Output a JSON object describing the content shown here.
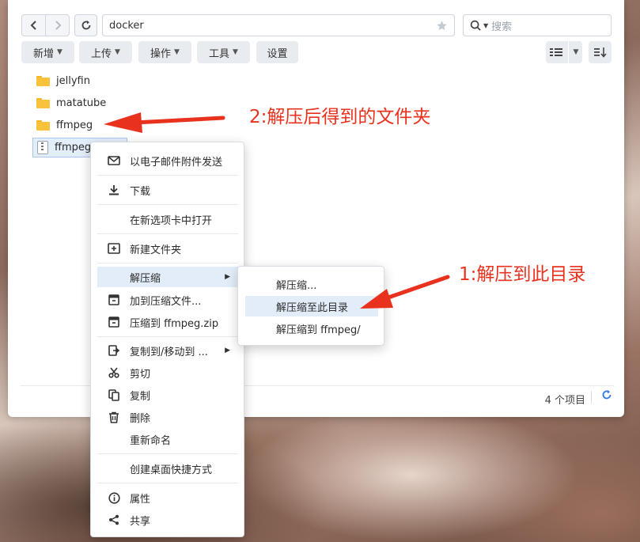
{
  "navigation": {
    "back_icon": "chevron-left-icon",
    "forward_icon": "chevron-right-icon",
    "refresh_icon": "refresh-icon"
  },
  "path": {
    "value": "docker",
    "favorite_icon": "star-icon"
  },
  "search": {
    "placeholder": "搜索",
    "icon": "search-icon"
  },
  "toolbar": {
    "buttons": [
      "新增",
      "上传",
      "操作",
      "工具"
    ],
    "settings_label": "设置",
    "view_icon": "list-view-icon",
    "sort_icon": "sort-icon"
  },
  "files": [
    {
      "name": "jellyfin",
      "type": "folder"
    },
    {
      "name": "matatube",
      "type": "folder"
    },
    {
      "name": "ffmpeg",
      "type": "folder"
    },
    {
      "name": "ffmpeg",
      "type": "zip",
      "selected": true
    }
  ],
  "status": {
    "count": "4 个项目"
  },
  "context_menu": {
    "items": [
      {
        "label": "以电子邮件附件发送",
        "icon": "mail-icon"
      },
      {
        "label": "下载",
        "icon": "download-icon"
      },
      {
        "label": "在新选项卡中打开",
        "icon": ""
      },
      {
        "label": "新建文件夹",
        "icon": "new-folder-icon"
      },
      {
        "label": "解压缩",
        "icon": "",
        "submenu": true
      },
      {
        "label": "加到压缩文件...",
        "icon": "archive-add-icon"
      },
      {
        "label": "压缩到 ffmpeg.zip",
        "icon": "archive-icon"
      },
      {
        "label": "复制到/移动到 ...",
        "icon": "copy-move-icon",
        "submenu": true
      },
      {
        "label": "剪切",
        "icon": "scissors-icon"
      },
      {
        "label": "复制",
        "icon": "copy-icon"
      },
      {
        "label": "删除",
        "icon": "trash-icon"
      },
      {
        "label": "重新命名",
        "icon": ""
      },
      {
        "label": "创建桌面快捷方式",
        "icon": ""
      },
      {
        "label": "属性",
        "icon": "info-icon"
      },
      {
        "label": "共享",
        "icon": "share-icon"
      }
    ]
  },
  "submenu": {
    "items": [
      "解压缩...",
      "解压缩至此目录",
      "解压缩到 ffmpeg/"
    ]
  },
  "annotations": {
    "first": "2:解压后得到的文件夹",
    "second": "1:解压到此目录",
    "color": "#e8321e"
  }
}
